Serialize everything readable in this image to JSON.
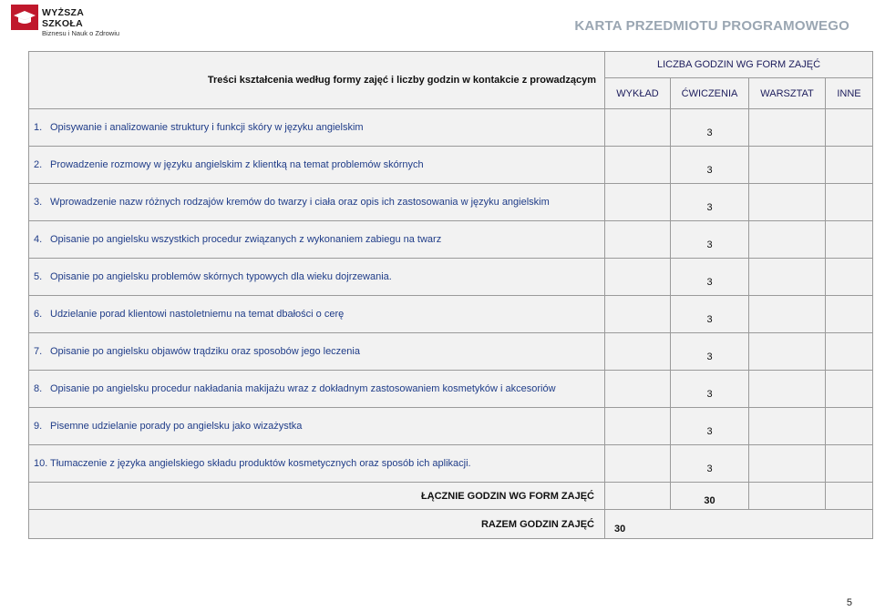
{
  "logo": {
    "name": "WYŻSZA SZKOŁA",
    "subtitle": "Biznesu i Nauk o Zdrowiu"
  },
  "doc_header": "KARTA PRZEDMIOTU PROGRAMOWEGO",
  "table": {
    "title": "Treści kształcenia według formy zajęć i liczby godzin w kontakcie z prowadzącym",
    "hours_header": "LICZBA GODZIN WG FORM ZAJĘĆ",
    "columns": [
      "WYKŁAD",
      "ĆWICZENIA",
      "WARSZTAT",
      "INNE"
    ],
    "rows": [
      {
        "num": "1.",
        "text": "Opisywanie i analizowanie struktury i funkcji skóry w języku angielskim",
        "cw": "3"
      },
      {
        "num": "2.",
        "text": "Prowadzenie rozmowy w języku angielskim z klientką na temat problemów skórnych",
        "cw": "3"
      },
      {
        "num": "3.",
        "text": "Wprowadzenie nazw różnych rodzajów kremów do twarzy i ciała oraz opis ich zastosowania w języku angielskim",
        "cw": "3"
      },
      {
        "num": "4.",
        "text": "Opisanie po angielsku wszystkich procedur związanych z wykonaniem zabiegu na twarz",
        "cw": "3"
      },
      {
        "num": "5.",
        "text": "Opisanie po angielsku problemów skórnych typowych dla wieku dojrzewania.",
        "cw": "3"
      },
      {
        "num": "6.",
        "text": "Udzielanie porad klientowi nastoletniemu na temat dbałości o cerę",
        "cw": "3"
      },
      {
        "num": "7.",
        "text": "Opisanie po angielsku objawów trądziku oraz sposobów jego leczenia",
        "cw": "3"
      },
      {
        "num": "8.",
        "text": "Opisanie po angielsku procedur nakładania makijażu wraz z dokładnym zastosowaniem kosmetyków i akcesoriów",
        "cw": "3"
      },
      {
        "num": "9.",
        "text": "Pisemne udzielanie porady po angielsku jako wizażystka",
        "cw": "3"
      },
      {
        "num": "10.",
        "text": "Tłumaczenie z języka angielskiego składu produktów kosmetycznych oraz sposób ich aplikacji.",
        "cw": "3"
      }
    ],
    "total_forms_label": "ŁĄCZNIE GODZIN WG FORM ZAJĘĆ",
    "total_forms_value": "30",
    "total_label": "RAZEM GODZIN ZAJĘĆ",
    "total_value": "30"
  },
  "page_number": "5"
}
